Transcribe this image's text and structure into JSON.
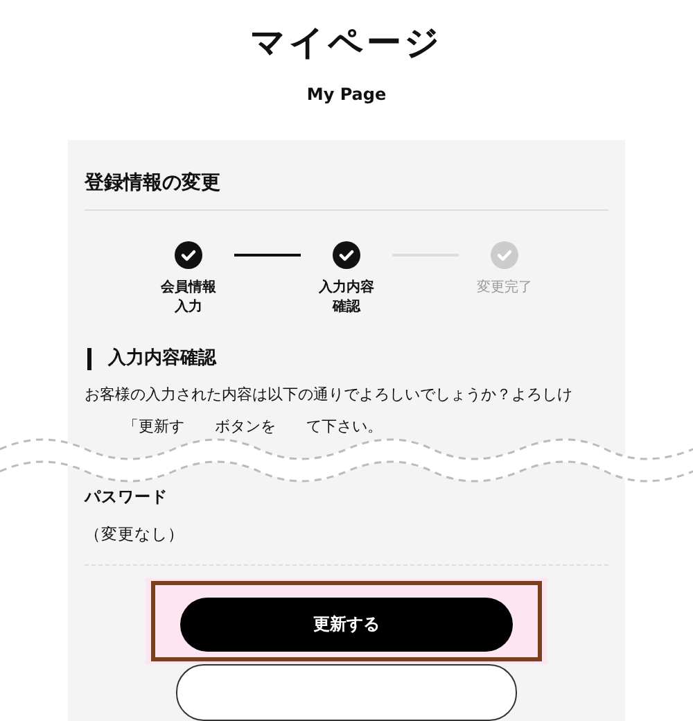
{
  "page": {
    "title": "マイページ",
    "subtitle": "My Page"
  },
  "card": {
    "heading": "登録情報の変更",
    "steps": [
      {
        "lines": [
          "会員情報",
          "入力"
        ],
        "done": true
      },
      {
        "lines": [
          "入力内容",
          "確認"
        ],
        "done": true
      },
      {
        "lines": [
          "変更完了"
        ],
        "done": false
      }
    ],
    "section_heading": "入力内容確認",
    "message_line": "お客様の入力された内容は以下の通りでよろしいでしょうか？よろしけ",
    "message_fragments": [
      "「更新す",
      "ボタンを",
      "て下さい。"
    ],
    "fields": [
      {
        "label": "パスワード",
        "value": "（変更なし）"
      }
    ],
    "submit_button": "更新する"
  }
}
